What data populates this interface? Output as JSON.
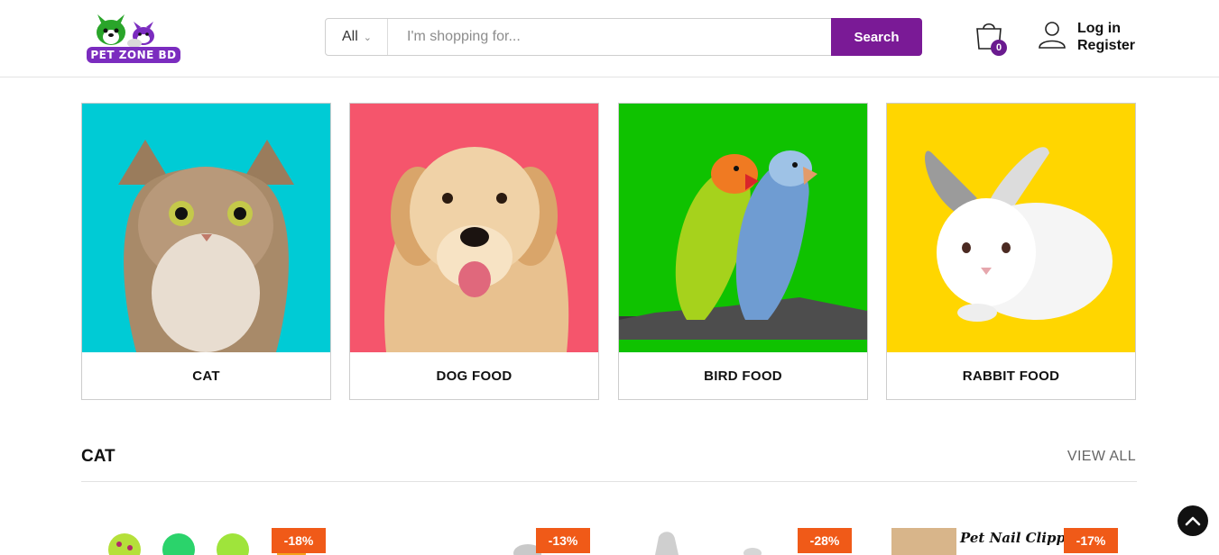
{
  "header": {
    "logo_text": "PET ZONE BD",
    "search": {
      "category": "All",
      "placeholder": "I'm shopping for...",
      "button": "Search"
    },
    "cart_count": "0",
    "login": "Log in",
    "register": "Register"
  },
  "categories": [
    {
      "label": "CAT",
      "bg": "#00cbd5"
    },
    {
      "label": "DOG FOOD",
      "bg": "#f5556c"
    },
    {
      "label": "BIRD FOOD",
      "bg": "#0fc200"
    },
    {
      "label": "RABBIT FOOD",
      "bg": "#ffd600"
    }
  ],
  "section": {
    "title": "CAT",
    "view_all": "VIEW ALL"
  },
  "products": [
    {
      "discount": "-18%"
    },
    {
      "discount": "-13%"
    },
    {
      "discount": "-28%"
    },
    {
      "discount": "-17%",
      "caption": "Pet Nail Clipper"
    }
  ],
  "colors": {
    "brand": "#7a1a96",
    "badge": "#f05a18"
  }
}
